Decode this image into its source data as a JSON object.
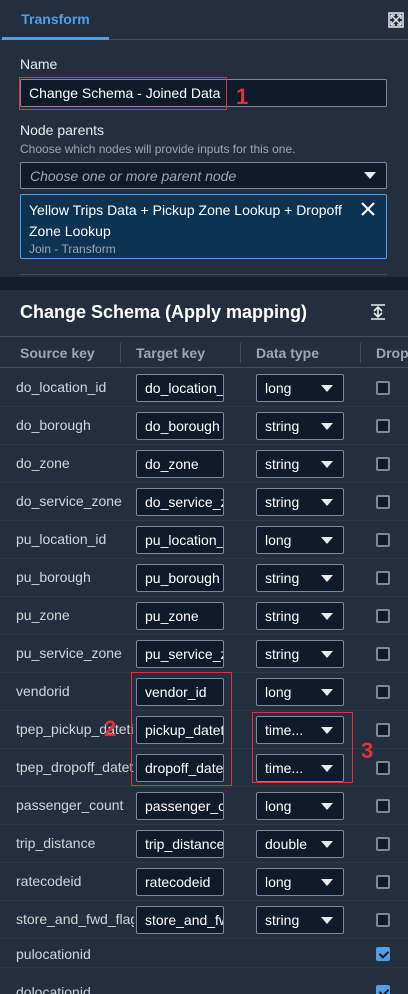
{
  "tabs": [
    {
      "label": "Transform",
      "active": true
    }
  ],
  "name_section": {
    "label": "Name",
    "value": "Change Schema - Joined Data"
  },
  "node_parents": {
    "label": "Node parents",
    "description": "Choose which nodes will provide inputs for this one.",
    "placeholder": "Choose one or more parent node",
    "selected": {
      "title": "Yellow Trips Data + Pickup Zone Lookup + Dropoff Zone Lookup",
      "subtitle": "Join - Transform"
    }
  },
  "schema": {
    "title": "Change Schema (Apply mapping)",
    "columns": [
      "Source key",
      "Target key",
      "Data type",
      "Drop"
    ],
    "rows": [
      {
        "source": "do_location_id",
        "target": "do_location_id",
        "type": "long",
        "drop": false
      },
      {
        "source": "do_borough",
        "target": "do_borough",
        "type": "string",
        "drop": false
      },
      {
        "source": "do_zone",
        "target": "do_zone",
        "type": "string",
        "drop": false
      },
      {
        "source": "do_service_zone",
        "target": "do_service_zone",
        "type": "string",
        "drop": false
      },
      {
        "source": "pu_location_id",
        "target": "pu_location_id",
        "type": "long",
        "drop": false
      },
      {
        "source": "pu_borough",
        "target": "pu_borough",
        "type": "string",
        "drop": false
      },
      {
        "source": "pu_zone",
        "target": "pu_zone",
        "type": "string",
        "drop": false
      },
      {
        "source": "pu_service_zone",
        "target": "pu_service_zone",
        "type": "string",
        "drop": false
      },
      {
        "source": "vendorid",
        "target": "vendor_id",
        "type": "long",
        "drop": false
      },
      {
        "source": "tpep_pickup_datetime",
        "target": "pickup_datetime",
        "type": "time...",
        "drop": false
      },
      {
        "source": "tpep_dropoff_datetime",
        "target": "dropoff_datetime",
        "type": "time...",
        "drop": false
      },
      {
        "source": "passenger_count",
        "target": "passenger_count",
        "type": "long",
        "drop": false
      },
      {
        "source": "trip_distance",
        "target": "trip_distance",
        "type": "double",
        "drop": false
      },
      {
        "source": "ratecodeid",
        "target": "ratecodeid",
        "type": "long",
        "drop": false
      },
      {
        "source": "store_and_fwd_flag",
        "target": "store_and_fwd_flag",
        "type": "string",
        "drop": false
      },
      {
        "source": "pulocationid",
        "target": null,
        "type": null,
        "drop": true
      },
      {
        "source": "dolocationid",
        "target": null,
        "type": null,
        "drop": true
      }
    ]
  },
  "annotations": [
    "1",
    "2",
    "3"
  ],
  "colors": {
    "accent": "#539fe5",
    "annotation": "#e0323c",
    "background": "#232f3e"
  }
}
